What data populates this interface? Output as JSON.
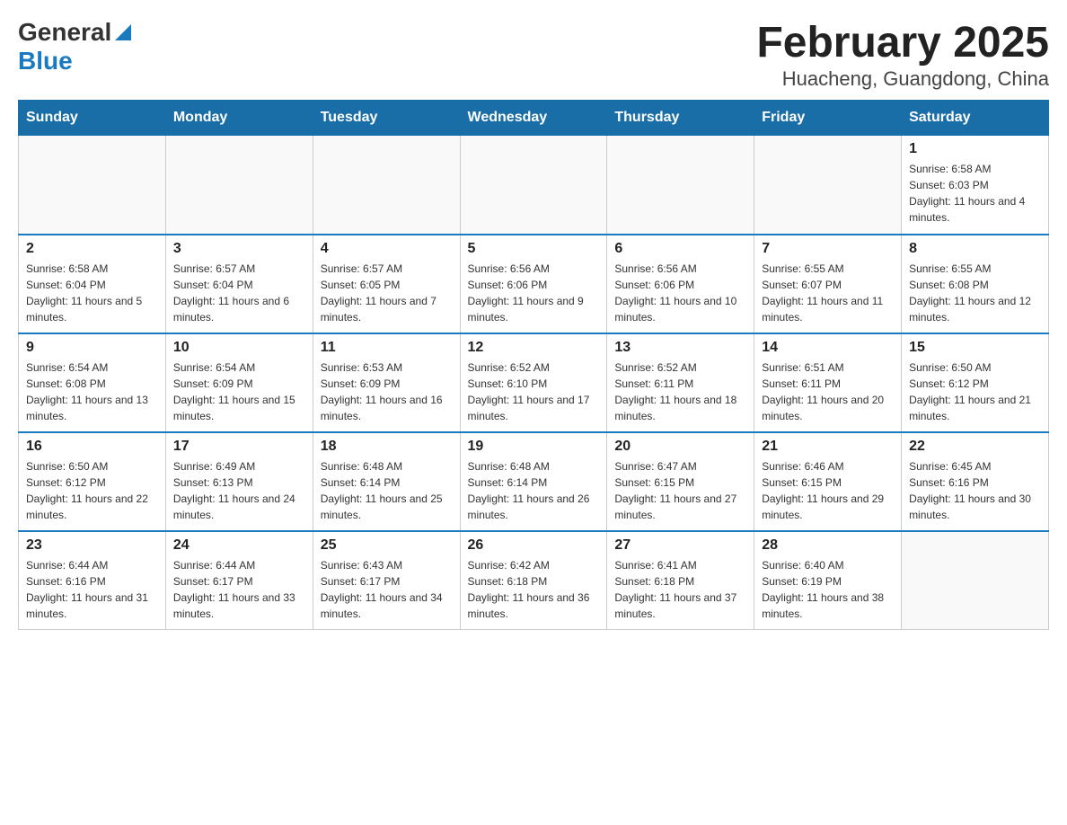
{
  "logo": {
    "general": "General",
    "blue": "Blue"
  },
  "title": "February 2025",
  "location": "Huacheng, Guangdong, China",
  "days_of_week": [
    "Sunday",
    "Monday",
    "Tuesday",
    "Wednesday",
    "Thursday",
    "Friday",
    "Saturday"
  ],
  "weeks": [
    [
      null,
      null,
      null,
      null,
      null,
      null,
      {
        "day": "1",
        "sunrise": "Sunrise: 6:58 AM",
        "sunset": "Sunset: 6:03 PM",
        "daylight": "Daylight: 11 hours and 4 minutes."
      }
    ],
    [
      {
        "day": "2",
        "sunrise": "Sunrise: 6:58 AM",
        "sunset": "Sunset: 6:04 PM",
        "daylight": "Daylight: 11 hours and 5 minutes."
      },
      {
        "day": "3",
        "sunrise": "Sunrise: 6:57 AM",
        "sunset": "Sunset: 6:04 PM",
        "daylight": "Daylight: 11 hours and 6 minutes."
      },
      {
        "day": "4",
        "sunrise": "Sunrise: 6:57 AM",
        "sunset": "Sunset: 6:05 PM",
        "daylight": "Daylight: 11 hours and 7 minutes."
      },
      {
        "day": "5",
        "sunrise": "Sunrise: 6:56 AM",
        "sunset": "Sunset: 6:06 PM",
        "daylight": "Daylight: 11 hours and 9 minutes."
      },
      {
        "day": "6",
        "sunrise": "Sunrise: 6:56 AM",
        "sunset": "Sunset: 6:06 PM",
        "daylight": "Daylight: 11 hours and 10 minutes."
      },
      {
        "day": "7",
        "sunrise": "Sunrise: 6:55 AM",
        "sunset": "Sunset: 6:07 PM",
        "daylight": "Daylight: 11 hours and 11 minutes."
      },
      {
        "day": "8",
        "sunrise": "Sunrise: 6:55 AM",
        "sunset": "Sunset: 6:08 PM",
        "daylight": "Daylight: 11 hours and 12 minutes."
      }
    ],
    [
      {
        "day": "9",
        "sunrise": "Sunrise: 6:54 AM",
        "sunset": "Sunset: 6:08 PM",
        "daylight": "Daylight: 11 hours and 13 minutes."
      },
      {
        "day": "10",
        "sunrise": "Sunrise: 6:54 AM",
        "sunset": "Sunset: 6:09 PM",
        "daylight": "Daylight: 11 hours and 15 minutes."
      },
      {
        "day": "11",
        "sunrise": "Sunrise: 6:53 AM",
        "sunset": "Sunset: 6:09 PM",
        "daylight": "Daylight: 11 hours and 16 minutes."
      },
      {
        "day": "12",
        "sunrise": "Sunrise: 6:52 AM",
        "sunset": "Sunset: 6:10 PM",
        "daylight": "Daylight: 11 hours and 17 minutes."
      },
      {
        "day": "13",
        "sunrise": "Sunrise: 6:52 AM",
        "sunset": "Sunset: 6:11 PM",
        "daylight": "Daylight: 11 hours and 18 minutes."
      },
      {
        "day": "14",
        "sunrise": "Sunrise: 6:51 AM",
        "sunset": "Sunset: 6:11 PM",
        "daylight": "Daylight: 11 hours and 20 minutes."
      },
      {
        "day": "15",
        "sunrise": "Sunrise: 6:50 AM",
        "sunset": "Sunset: 6:12 PM",
        "daylight": "Daylight: 11 hours and 21 minutes."
      }
    ],
    [
      {
        "day": "16",
        "sunrise": "Sunrise: 6:50 AM",
        "sunset": "Sunset: 6:12 PM",
        "daylight": "Daylight: 11 hours and 22 minutes."
      },
      {
        "day": "17",
        "sunrise": "Sunrise: 6:49 AM",
        "sunset": "Sunset: 6:13 PM",
        "daylight": "Daylight: 11 hours and 24 minutes."
      },
      {
        "day": "18",
        "sunrise": "Sunrise: 6:48 AM",
        "sunset": "Sunset: 6:14 PM",
        "daylight": "Daylight: 11 hours and 25 minutes."
      },
      {
        "day": "19",
        "sunrise": "Sunrise: 6:48 AM",
        "sunset": "Sunset: 6:14 PM",
        "daylight": "Daylight: 11 hours and 26 minutes."
      },
      {
        "day": "20",
        "sunrise": "Sunrise: 6:47 AM",
        "sunset": "Sunset: 6:15 PM",
        "daylight": "Daylight: 11 hours and 27 minutes."
      },
      {
        "day": "21",
        "sunrise": "Sunrise: 6:46 AM",
        "sunset": "Sunset: 6:15 PM",
        "daylight": "Daylight: 11 hours and 29 minutes."
      },
      {
        "day": "22",
        "sunrise": "Sunrise: 6:45 AM",
        "sunset": "Sunset: 6:16 PM",
        "daylight": "Daylight: 11 hours and 30 minutes."
      }
    ],
    [
      {
        "day": "23",
        "sunrise": "Sunrise: 6:44 AM",
        "sunset": "Sunset: 6:16 PM",
        "daylight": "Daylight: 11 hours and 31 minutes."
      },
      {
        "day": "24",
        "sunrise": "Sunrise: 6:44 AM",
        "sunset": "Sunset: 6:17 PM",
        "daylight": "Daylight: 11 hours and 33 minutes."
      },
      {
        "day": "25",
        "sunrise": "Sunrise: 6:43 AM",
        "sunset": "Sunset: 6:17 PM",
        "daylight": "Daylight: 11 hours and 34 minutes."
      },
      {
        "day": "26",
        "sunrise": "Sunrise: 6:42 AM",
        "sunset": "Sunset: 6:18 PM",
        "daylight": "Daylight: 11 hours and 36 minutes."
      },
      {
        "day": "27",
        "sunrise": "Sunrise: 6:41 AM",
        "sunset": "Sunset: 6:18 PM",
        "daylight": "Daylight: 11 hours and 37 minutes."
      },
      {
        "day": "28",
        "sunrise": "Sunrise: 6:40 AM",
        "sunset": "Sunset: 6:19 PM",
        "daylight": "Daylight: 11 hours and 38 minutes."
      },
      null
    ]
  ]
}
